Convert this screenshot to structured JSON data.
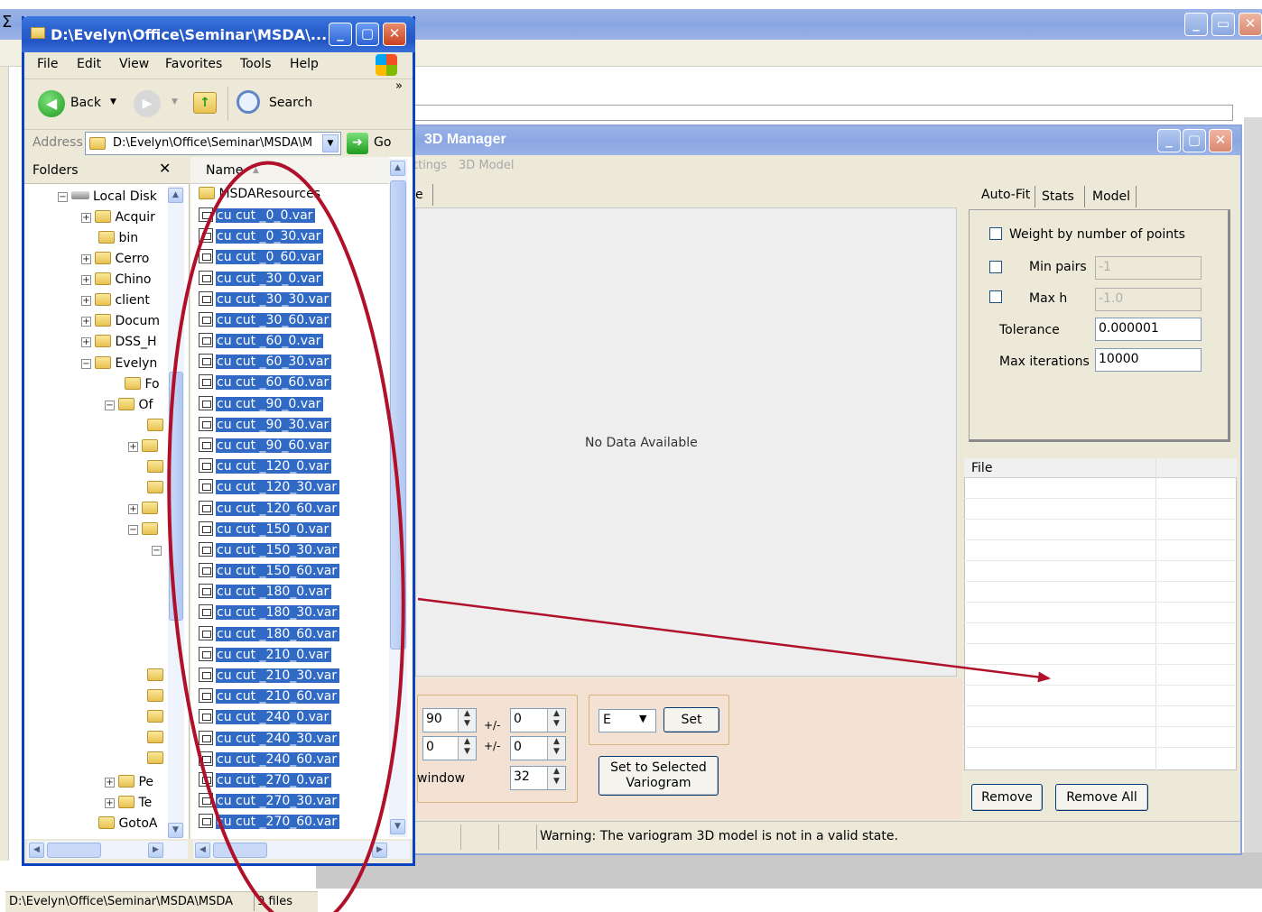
{
  "explorer": {
    "title": "D:\\Evelyn\\Office\\Seminar\\MSDA\\...",
    "menu": [
      "File",
      "Edit",
      "View",
      "Favorites",
      "Tools",
      "Help"
    ],
    "toolbar": {
      "back": "Back",
      "search": "Search",
      "more": "»"
    },
    "address": {
      "label": "Address",
      "value": "D:\\Evelyn\\Office\\Seminar\\MSDA\\M",
      "go": "Go"
    },
    "folders_label": "Folders",
    "name_col": "Name",
    "tree": [
      "Local Disk",
      "Acquir",
      "bin",
      "Cerro",
      "Chino",
      "client",
      "Docum",
      "DSS_H",
      "Evelyn",
      "Fo",
      "Of",
      "Pe",
      "Te",
      "GotoA"
    ],
    "resource_folder": "MSDAResources",
    "files": [
      "cu cut _0_0.var",
      "cu cut _0_30.var",
      "cu cut _0_60.var",
      "cu cut _30_0.var",
      "cu cut _30_30.var",
      "cu cut _30_60.var",
      "cu cut _60_0.var",
      "cu cut _60_30.var",
      "cu cut _60_60.var",
      "cu cut _90_0.var",
      "cu cut _90_30.var",
      "cu cut _90_60.var",
      "cu cut _120_0.var",
      "cu cut _120_30.var",
      "cu cut _120_60.var",
      "cu cut _150_0.var",
      "cu cut _150_30.var",
      "cu cut _150_60.var",
      "cu cut _180_0.var",
      "cu cut _180_30.var",
      "cu cut _180_60.var",
      "cu cut _210_0.var",
      "cu cut _210_30.var",
      "cu cut _210_60.var",
      "cu cut _240_0.var",
      "cu cut _240_30.var",
      "cu cut _240_60.var",
      "cu cut _270_0.var",
      "cu cut _270_30.var",
      "cu cut _270_60.var"
    ],
    "status_path": "D:\\Evelyn\\Office\\Seminar\\MSDA\\MSDA",
    "status_count": "9 files"
  },
  "manager": {
    "title": "3D Manager",
    "menu": [
      "ttings",
      "3D Model"
    ],
    "tab_fragment": "e",
    "no_data": "No Data Available",
    "controls": {
      "dir1": "90",
      "pm": "+/-",
      "tol1": "0",
      "dir2": "0",
      "tol2": "0",
      "window_label": "window",
      "window_val": "32",
      "combo": "E",
      "set": "Set",
      "set_selected": "Set to Selected Variogram"
    },
    "status_warning": "Warning: The variogram 3D model is not in a valid state.",
    "tabs": [
      "Auto-Fit",
      "Stats",
      "Model"
    ],
    "autofit": {
      "weight": "Weight by number of points",
      "min_pairs_label": "Min pairs",
      "min_pairs": "-1",
      "max_h_label": "Max h",
      "max_h": "-1.0",
      "tolerance_label": "Tolerance",
      "tolerance": "0.000001",
      "max_iter_label": "Max iterations",
      "max_iter": "10000"
    },
    "file_col": "File",
    "remove": "Remove",
    "remove_all": "Remove All"
  },
  "colors": {
    "selection": "#316ac5",
    "annotation": "#b0102a",
    "beige": "#ece9d8",
    "peach": "#f3e2d4"
  }
}
